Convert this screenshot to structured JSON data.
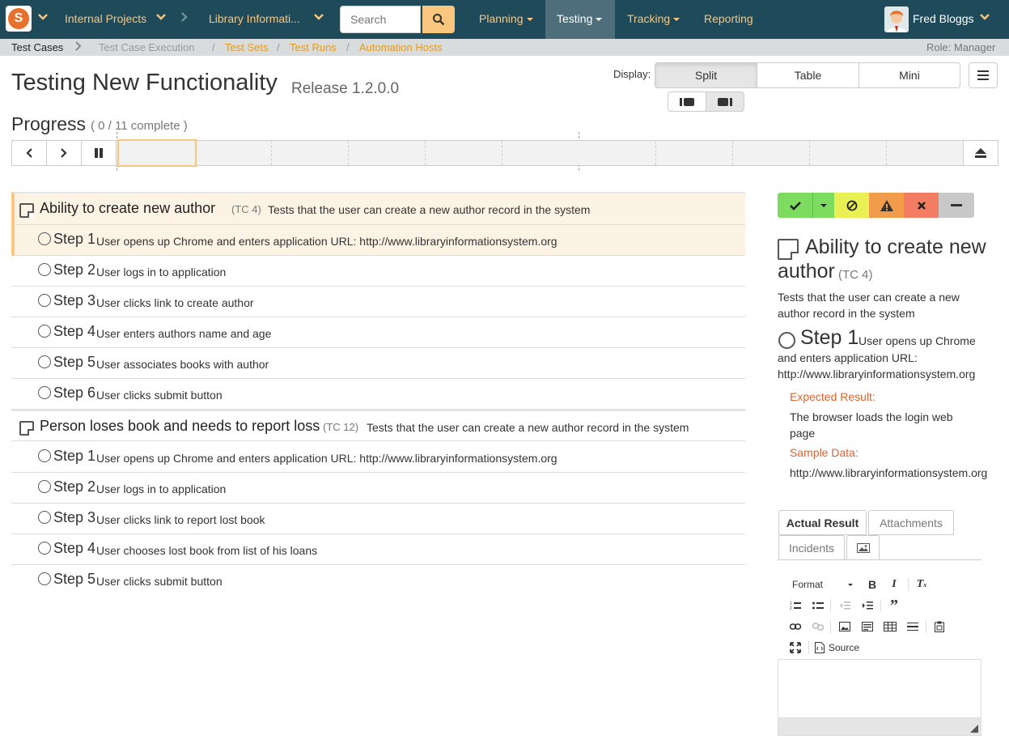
{
  "nav": {
    "project": "Internal Projects",
    "product": "Library Informati...",
    "search_placeholder": "Search",
    "menus": [
      "Planning",
      "Testing",
      "Tracking",
      "Reporting"
    ],
    "user": "Fred Bloggs"
  },
  "subnav": {
    "items": [
      "Test Cases",
      "Test Case Execution",
      "Test Sets",
      "Test Runs",
      "Automation Hosts"
    ],
    "role": "Role: Manager"
  },
  "title": "Testing New Functionality",
  "release": "Release 1.2.0.0",
  "display": {
    "label": "Display:",
    "options": [
      "Split",
      "Table",
      "Mini"
    ],
    "selected": "Split"
  },
  "progress": {
    "title": "Progress",
    "subtitle_open": "( 0  / ",
    "subtitle_link": "11 complete",
    "subtitle_close": " )",
    "completed": 0,
    "total": 11
  },
  "test_cases": [
    {
      "name": "Ability to create new author",
      "id": "(TC 4)",
      "description": "Tests that the user can create a new author record in the system",
      "steps": [
        {
          "label": "Step 1",
          "text": "User opens up Chrome and enters application URL: http://www.libraryinformationsystem.org"
        },
        {
          "label": "Step 2",
          "text": "User logs in to application"
        },
        {
          "label": "Step 3",
          "text": "User clicks link to create author"
        },
        {
          "label": "Step 4",
          "text": "User enters authors name and age"
        },
        {
          "label": "Step 5",
          "text": "User associates books with author"
        },
        {
          "label": "Step 6",
          "text": "User clicks submit button"
        }
      ]
    },
    {
      "name": "Person loses book and needs to report loss",
      "id": "(TC 12)",
      "description": "Tests that the user can create a new author record in the system",
      "steps": [
        {
          "label": "Step 1",
          "text": "User opens up Chrome and enters application URL: http://www.libraryinformationsystem.org"
        },
        {
          "label": "Step 2",
          "text": "User logs in to application"
        },
        {
          "label": "Step 3",
          "text": "User clicks link to report lost book"
        },
        {
          "label": "Step 4",
          "text": "User chooses lost book from list of his loans"
        },
        {
          "label": "Step 5",
          "text": "User clicks submit button"
        }
      ]
    }
  ],
  "detail": {
    "title_line1": "Ability to create new",
    "title_line2": "author",
    "tc_id": "(TC 4)",
    "description": "Tests that the user can create a new author record in the system",
    "step_label": "Step 1",
    "step_text_1": "User opens up Chrome",
    "step_text_2": "and enters application URL: http://www.libraryinformationsystem.org",
    "expected_label": "Expected Result:",
    "expected_value": "The browser loads the login web page",
    "sample_label": "Sample Data:",
    "sample_value": "http://www.libraryinformationsystem.org",
    "tabs": [
      "Actual Result",
      "Attachments",
      "Incidents"
    ],
    "format_label": "Format",
    "source_label": "Source"
  },
  "colors": {
    "nav_bg": "#1e4a5a",
    "accent": "#fbc67d",
    "pass": "#7ddc5f",
    "blocked": "#e8f054",
    "caution": "#f09c4a",
    "fail": "#f37c62",
    "na": "#c8c8c8"
  }
}
